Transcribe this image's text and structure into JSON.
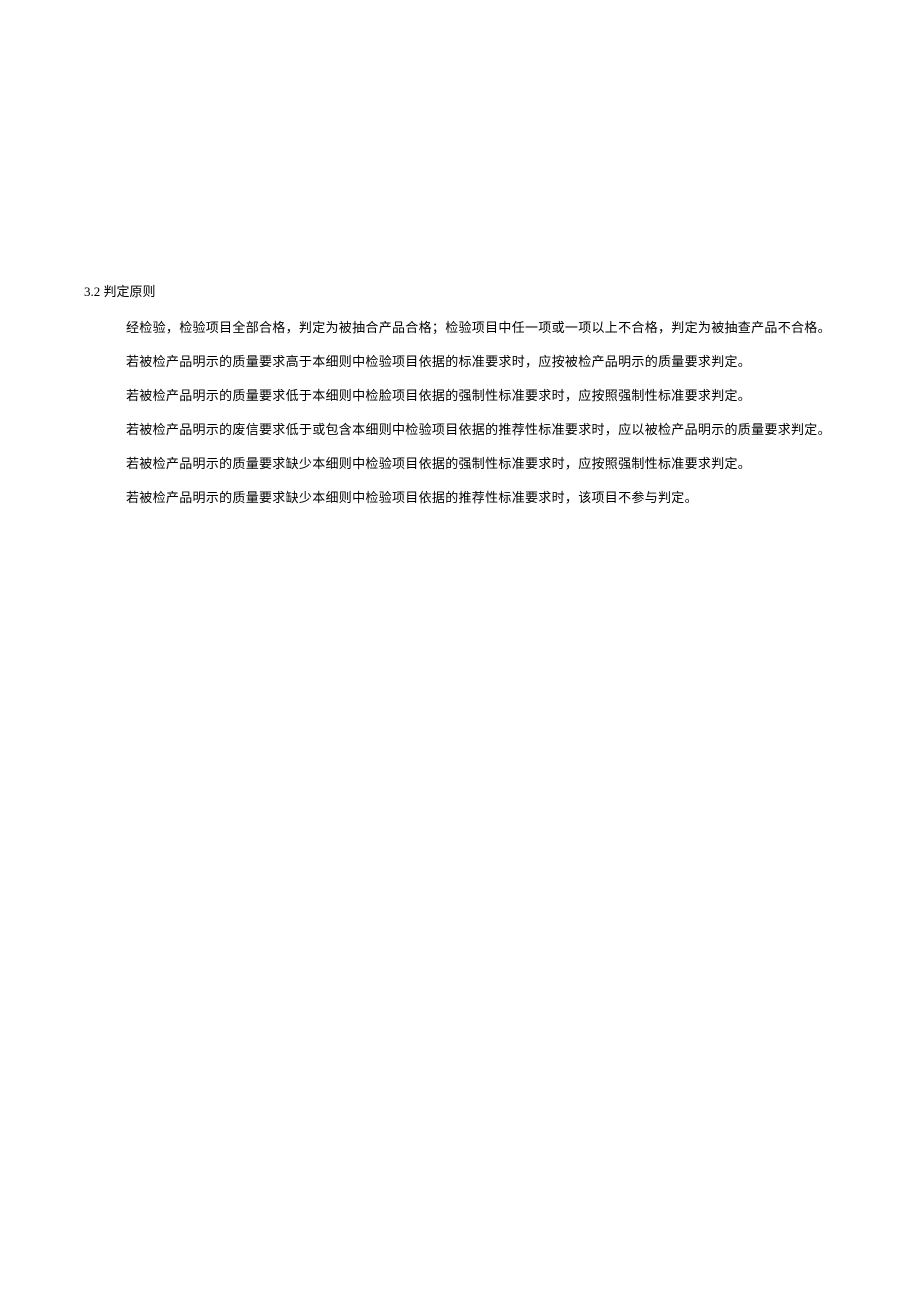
{
  "section": {
    "heading": "3.2 判定原则",
    "paragraphs": [
      "经检验，检验项目全部合格，判定为被抽合产品合格；检验项目中任一项或一项以上不合格，判定为被抽查产品不合格。",
      "若被检产品明示的质量要求高于本细则中检验项目依据的标准要求时，应按被检产品明示的质量要求判定。",
      "若被检产品明示的质量要求低于本细则中检脸项目依据的强制性标准要求时，应按照强制性标准要求判定。",
      "若被检产品明示的废信要求低于或包含本细则中检验项目依据的推荐性标准要求时，应以被检产品明示的质量要求判定。",
      "若被检产品明示的质量要求缺少本细则中检验项目依据的强制性标准要求时，应按照强制性标准要求判定。",
      "若被检产品明示的质量要求缺少本细则中检验项目依据的推荐性标准要求时，该项目不参与判定。"
    ]
  }
}
